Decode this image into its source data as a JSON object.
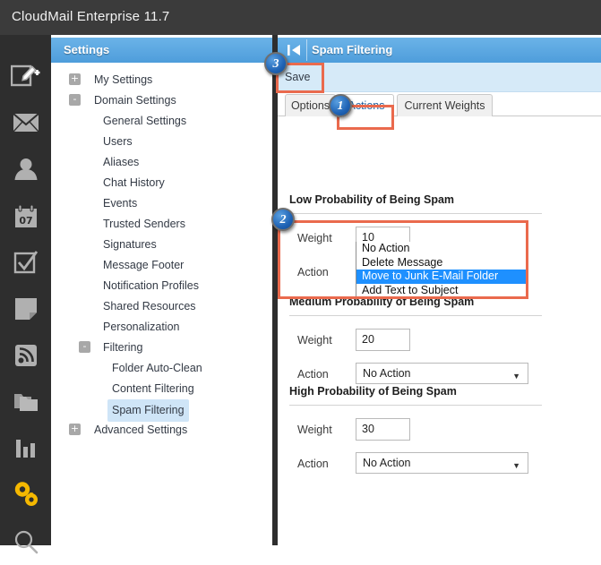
{
  "titlebar": {
    "app_title": "CloudMail Enterprise 11.7"
  },
  "icon_rail": {
    "items": [
      {
        "name": "compose-icon",
        "label": "Compose"
      },
      {
        "name": "mail-icon",
        "label": "Mail"
      },
      {
        "name": "contacts-icon",
        "label": "Contacts"
      },
      {
        "name": "calendar-icon",
        "label": "Calendar",
        "day": "07"
      },
      {
        "name": "tasks-icon",
        "label": "Tasks"
      },
      {
        "name": "notes-icon",
        "label": "Notes"
      },
      {
        "name": "rss-icon",
        "label": "RSS Feeds"
      },
      {
        "name": "folders-icon",
        "label": "Folders"
      },
      {
        "name": "reports-icon",
        "label": "Reports"
      },
      {
        "name": "settings-gears-icon",
        "label": "Settings"
      },
      {
        "name": "search-icon",
        "label": "Search"
      }
    ],
    "active_item": "settings-gears-icon",
    "active_color": "#f5b800"
  },
  "tree_panel": {
    "header": "Settings",
    "nodes": [
      {
        "label": "My Settings",
        "indent": 0,
        "toggle": "+",
        "selected": false
      },
      {
        "label": "Domain Settings",
        "indent": 0,
        "toggle": "-",
        "selected": false
      },
      {
        "label": "General Settings",
        "indent": 1,
        "toggle": "",
        "selected": false
      },
      {
        "label": "Users",
        "indent": 1,
        "toggle": "",
        "selected": false
      },
      {
        "label": "Aliases",
        "indent": 1,
        "toggle": "",
        "selected": false
      },
      {
        "label": "Chat History",
        "indent": 1,
        "toggle": "",
        "selected": false
      },
      {
        "label": "Events",
        "indent": 1,
        "toggle": "",
        "selected": false
      },
      {
        "label": "Trusted Senders",
        "indent": 1,
        "toggle": "",
        "selected": false
      },
      {
        "label": "Signatures",
        "indent": 1,
        "toggle": "",
        "selected": false
      },
      {
        "label": "Message Footer",
        "indent": 1,
        "toggle": "",
        "selected": false
      },
      {
        "label": "Notification Profiles",
        "indent": 1,
        "toggle": "",
        "selected": false
      },
      {
        "label": "Shared Resources",
        "indent": 1,
        "toggle": "",
        "selected": false
      },
      {
        "label": "Personalization",
        "indent": 1,
        "toggle": "",
        "selected": false
      },
      {
        "label": "Filtering",
        "indent": 1,
        "toggle": "-",
        "selected": false
      },
      {
        "label": "Folder Auto-Clean",
        "indent": 2,
        "toggle": "",
        "selected": false
      },
      {
        "label": "Content Filtering",
        "indent": 2,
        "toggle": "",
        "selected": false
      },
      {
        "label": "Spam Filtering",
        "indent": 2,
        "toggle": "",
        "selected": true
      },
      {
        "label": "Advanced Settings",
        "indent": 0,
        "toggle": "+",
        "selected": false
      }
    ]
  },
  "right_pane": {
    "header_title": "Spam Filtering",
    "collapse_icon": "collapse-left-icon",
    "toolbar": {
      "save_label": "Save"
    },
    "tabs": [
      {
        "label": "Options",
        "active": false
      },
      {
        "label": "Actions",
        "active": true
      },
      {
        "label": "Current Weights",
        "active": false
      }
    ],
    "sections": [
      {
        "title": "Low Probability of Being Spam",
        "weight_label": "Weight",
        "weight_value": "10",
        "action_label": "Action",
        "action_value": "Move to Junk E-Mail Folder",
        "open": true
      },
      {
        "title": "Medium Probability of Being Spam",
        "weight_label": "Weight",
        "weight_value": "20",
        "action_label": "Action",
        "action_value": "No Action",
        "open": false
      },
      {
        "title": "High Probability of Being Spam",
        "weight_label": "Weight",
        "weight_value": "30",
        "action_label": "Action",
        "action_value": "No Action",
        "open": false
      }
    ],
    "dropdown_options": [
      {
        "label": "No Action",
        "selected": false
      },
      {
        "label": "Delete Message",
        "selected": false
      },
      {
        "label": "Move to Junk E-Mail Folder",
        "selected": true
      },
      {
        "label": "Add Text to Subject",
        "selected": false
      }
    ]
  },
  "annotations": {
    "highlight_color": "#ea6a4d",
    "badges": [
      {
        "number": "1",
        "target": "tab-actions"
      },
      {
        "number": "2",
        "target": "action-dropdown-low"
      },
      {
        "number": "3",
        "target": "save-button"
      }
    ]
  }
}
